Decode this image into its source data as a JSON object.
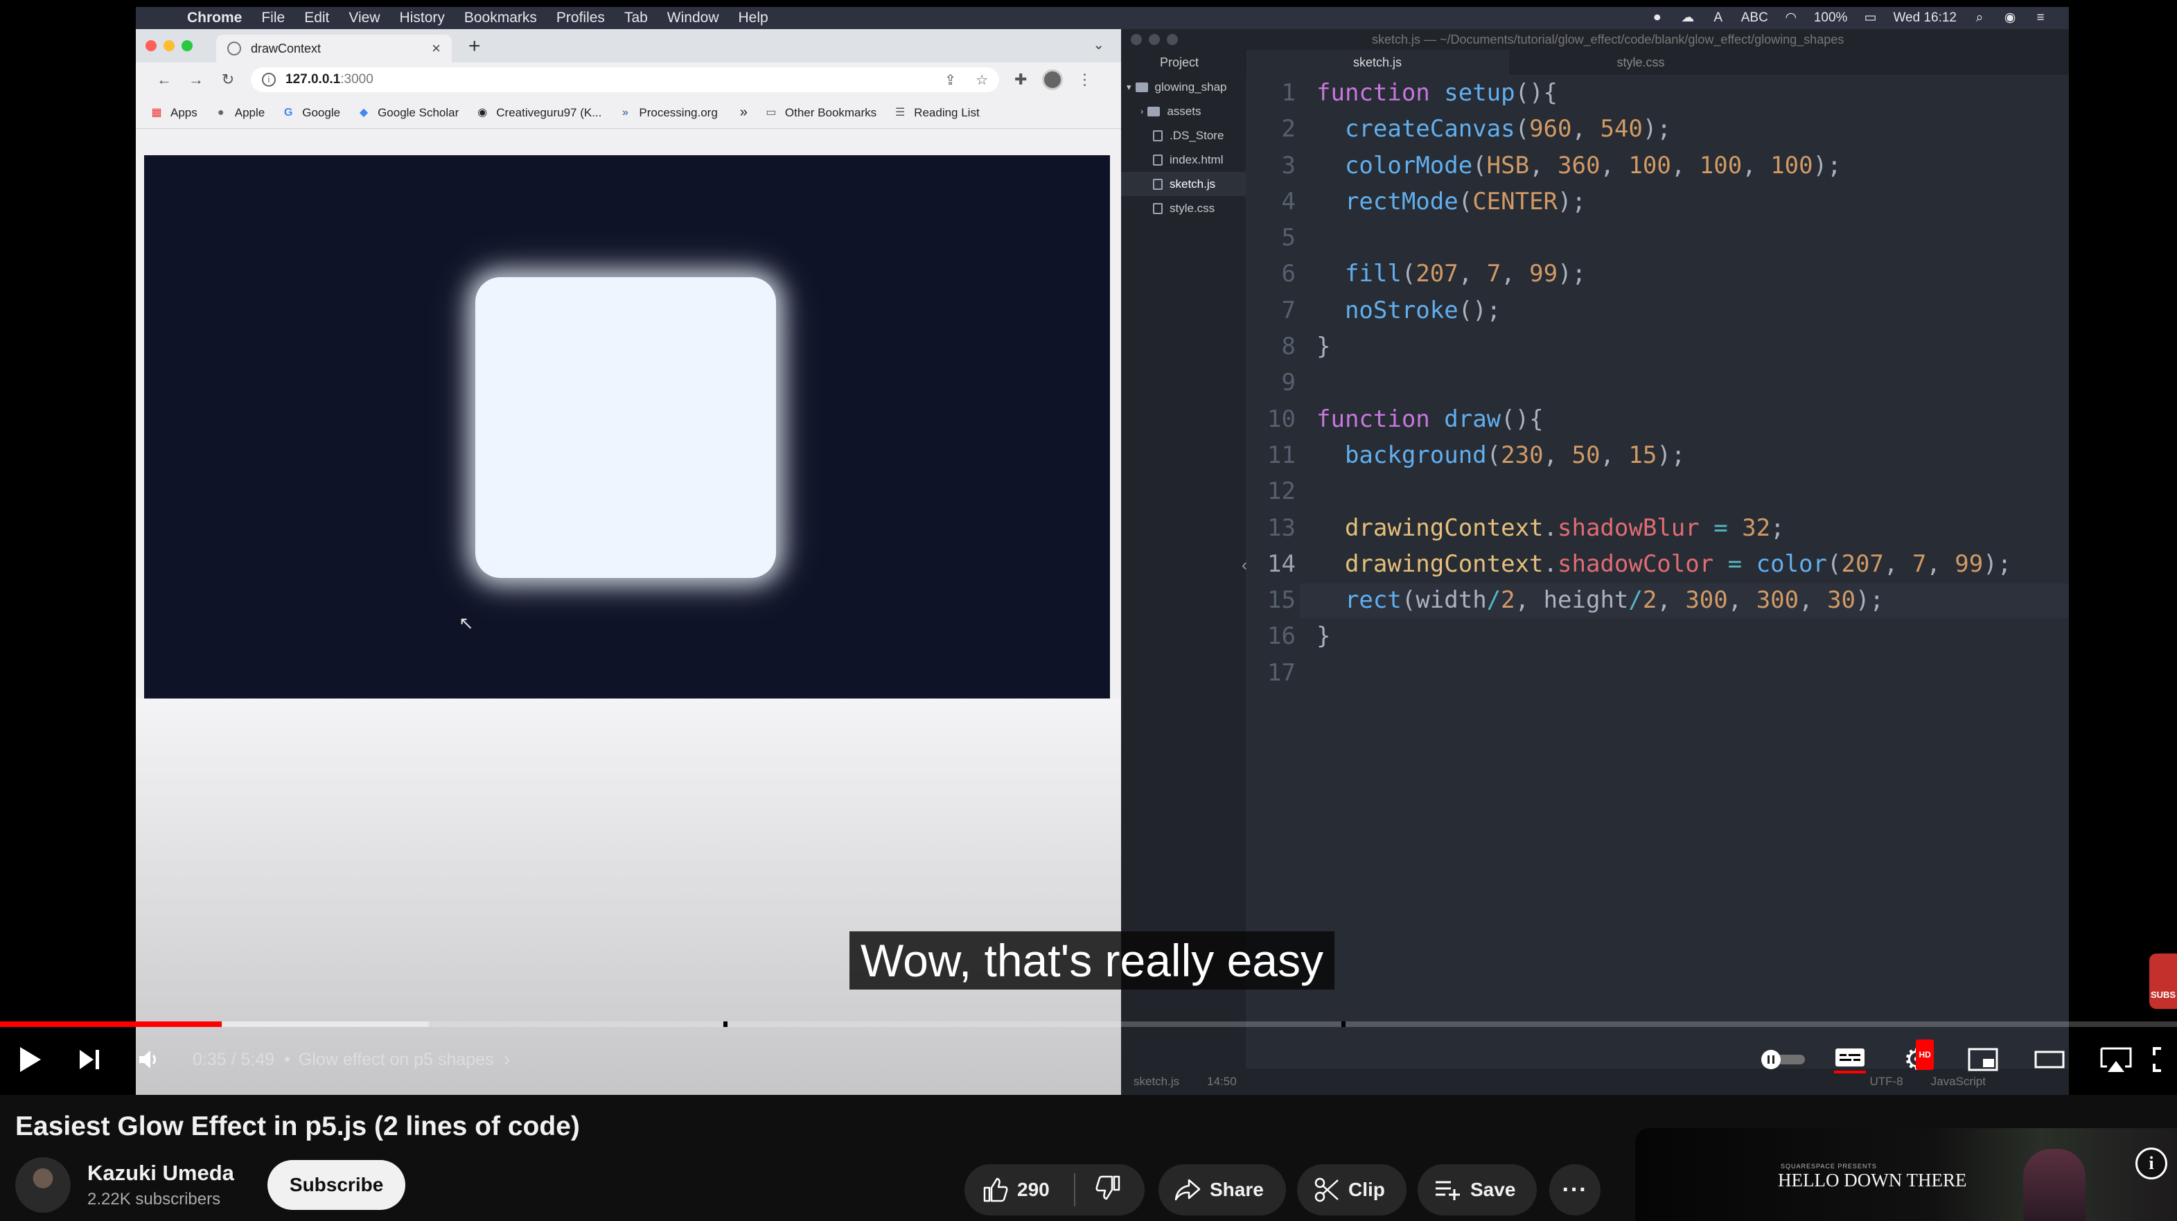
{
  "menubar": {
    "app": "Chrome",
    "items": [
      "File",
      "Edit",
      "View",
      "History",
      "Bookmarks",
      "Profiles",
      "Tab",
      "Window",
      "Help"
    ],
    "input_source": "ABC",
    "battery": "100%",
    "clock": "Wed 16:12"
  },
  "browser": {
    "tab_title": "drawContext",
    "url_host": "127.0.0.1",
    "url_port": ":3000",
    "bookmarks": [
      {
        "label": "Apps",
        "icon": "apps-grid-icon"
      },
      {
        "label": "Apple",
        "icon": "apple-icon"
      },
      {
        "label": "Google",
        "icon": "google-icon"
      },
      {
        "label": "Google Scholar",
        "icon": "scholar-icon"
      },
      {
        "label": "Creativeguru97 (K...",
        "icon": "github-icon"
      },
      {
        "label": "Processing.org",
        "icon": "processing-icon"
      }
    ],
    "other_bookmarks": "Other Bookmarks",
    "reading_list": "Reading List"
  },
  "editor": {
    "window_title": "sketch.js — ~/Documents/tutorial/glow_effect/code/blank/glow_effect/glowing_shapes",
    "project_tab": "Project",
    "file_tabs": [
      "sketch.js",
      "style.css"
    ],
    "tree": [
      {
        "label": "glowing_shap",
        "type": "root"
      },
      {
        "label": "assets",
        "type": "dir"
      },
      {
        "label": ".DS_Store",
        "type": "file"
      },
      {
        "label": "index.html",
        "type": "file"
      },
      {
        "label": "sketch.js",
        "type": "file",
        "selected": true
      },
      {
        "label": "style.css",
        "type": "file"
      }
    ],
    "line_numbers": [
      "1",
      "2",
      "3",
      "4",
      "5",
      "6",
      "7",
      "8",
      "9",
      "10",
      "11",
      "12",
      "13",
      "14",
      "15",
      "16",
      "17"
    ],
    "status_file": "sketch.js",
    "status_pos": "14:50",
    "status_encoding": "UTF-8",
    "status_grammar": "JavaScript"
  },
  "caption": "Wow, that's really easy",
  "player": {
    "time": "0:35 / 5:49",
    "chapter": "Glow effect on p5 shapes",
    "progress_played_fraction": 0.102,
    "progress_loaded_fraction": 0.197,
    "hd_badge": "HD",
    "subs_side_label": "SUBS"
  },
  "video": {
    "title": "Easiest Glow Effect in p5.js (2 lines of code)",
    "channel_name": "Kazuki Umeda",
    "subscribers": "2.22K subscribers",
    "subscribe_label": "Subscribe",
    "likes": "290",
    "share_label": "Share",
    "clip_label": "Clip",
    "save_label": "Save"
  },
  "ad": {
    "presents": "SQUARESPACE PRESENTS",
    "title": "HELLO DOWN THERE"
  }
}
